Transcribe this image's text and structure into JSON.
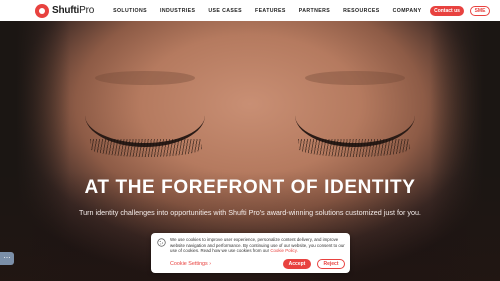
{
  "header": {
    "logo_brand": "Shufti",
    "logo_suffix": "Pro",
    "nav": [
      "SOLUTIONS",
      "INDUSTRIES",
      "USE CASES",
      "FEATURES",
      "PARTNERS",
      "RESOURCES",
      "COMPANY"
    ],
    "contact_label": "Contact us",
    "sme_label": "SME"
  },
  "hero": {
    "title": "AT THE FOREFRONT OF IDENTITY",
    "subtitle": "Turn identity challenges into opportunities with Shufti Pro's award-winning solutions customized just for you."
  },
  "icons": {
    "chat": "chat-icon",
    "cookie": "cookie-icon"
  },
  "cookie_banner": {
    "text": "We use cookies to improve user experience, personalize content delivery, and improve website navigation and performance. By continuing use of our website, you consent to our use of cookies. Read how we use cookies from our ",
    "policy_link": "Cookie Policy.",
    "settings_label": "Cookie Settings",
    "settings_arrow": "›",
    "accept_label": "Accept",
    "reject_label": "Reject"
  },
  "colors": {
    "brand_red": "#e8423f"
  }
}
